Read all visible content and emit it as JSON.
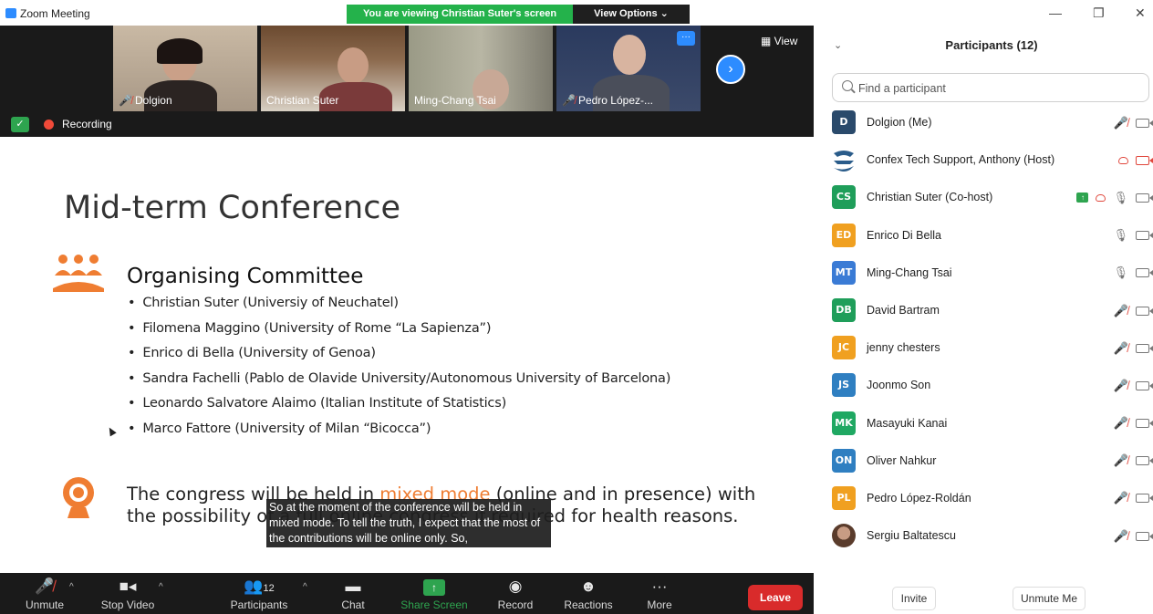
{
  "window": {
    "title": "Zoom Meeting",
    "viewing_banner": "You are viewing Christian Suter's screen",
    "view_options": "View Options ⌄",
    "controls": {
      "minimize": "—",
      "restore": "❐",
      "close": "✕"
    }
  },
  "video_strip": {
    "tiles": [
      {
        "name": "Dolgion",
        "muted": true
      },
      {
        "name": "Christian Suter",
        "muted": false
      },
      {
        "name": "Ming-Chang  Tsai",
        "muted": false
      },
      {
        "name": "Pedro López-...",
        "muted": true
      }
    ],
    "view_label": "View"
  },
  "status": {
    "recording_label": "Recording"
  },
  "slide": {
    "title": "Mid-term Conference",
    "committee_heading": "Organising Committee",
    "committee_members": [
      "Christian Suter (Universiy of Neuchatel)",
      "Filomena Maggino (University of Rome “La Sapienza”)",
      "Enrico di Bella (University of Genoa)",
      "Sandra Fachelli (Pablo de Olavide University/Autonomous University of Barcelona)",
      "Leonardo Salvatore Alaimo (Italian Institute of Statistics)",
      "Marco Fattore (University of Milan “Bicocca”)"
    ],
    "congress_before": "The congress will be held in ",
    "congress_highlight": "mixed mode",
    "congress_after": " (online and in presence) with the possibility of a full online congress if required for health reasons.",
    "highlight_color": "#ef7d32",
    "caption": "So at the moment of the conference will be held in mixed mode. To tell the truth, I expect that the most of the contributions will be online only. So,"
  },
  "toolbar": {
    "unmute": "Unmute",
    "stop_video": "Stop Video",
    "participants": "Participants",
    "participants_count": "12",
    "chat": "Chat",
    "share_screen": "Share Screen",
    "record": "Record",
    "reactions": "Reactions",
    "more": "More",
    "leave": "Leave"
  },
  "panel": {
    "title": "Participants (12)",
    "search_placeholder": "Find a participant",
    "participants": [
      {
        "initials": "D",
        "name": "Dolgion (Me)",
        "color": "#2a4a6b",
        "mic": "off",
        "cam": "on"
      },
      {
        "initials": "",
        "name": "Confex Tech Support, Anthony (Host)",
        "color": "#2a5c8a",
        "mic": "none",
        "cam": "off",
        "cloud": true
      },
      {
        "initials": "CS",
        "name": "Christian Suter (Co-host)",
        "color": "#1f9e5a",
        "mic": "on",
        "cam": "on",
        "cloud": true,
        "sharing": true
      },
      {
        "initials": "ED",
        "name": "Enrico Di Bella",
        "color": "#f0a020",
        "mic": "on",
        "cam": "on"
      },
      {
        "initials": "MT",
        "name": "Ming-Chang  Tsai",
        "color": "#3a7bd5",
        "mic": "on",
        "cam": "on"
      },
      {
        "initials": "DB",
        "name": "David Bartram",
        "color": "#1f9e5a",
        "mic": "off",
        "cam": "on"
      },
      {
        "initials": "JC",
        "name": "jenny chesters",
        "color": "#f0a020",
        "mic": "off",
        "cam": "on"
      },
      {
        "initials": "JS",
        "name": "Joonmo Son",
        "color": "#2f7fc1",
        "mic": "off",
        "cam": "on"
      },
      {
        "initials": "MK",
        "name": "Masayuki Kanai",
        "color": "#1fa862",
        "mic": "off",
        "cam": "on"
      },
      {
        "initials": "ON",
        "name": "Oliver Nahkur",
        "color": "#2f7fc1",
        "mic": "off",
        "cam": "on"
      },
      {
        "initials": "PL",
        "name": "Pedro López-Roldán",
        "color": "#f0a020",
        "mic": "off",
        "cam": "on"
      },
      {
        "initials": "",
        "name": "Sergiu Baltatescu",
        "color": "#7a5a4a",
        "mic": "off",
        "cam": "on",
        "photo": true
      }
    ],
    "invite": "Invite",
    "unmute_me": "Unmute Me"
  }
}
